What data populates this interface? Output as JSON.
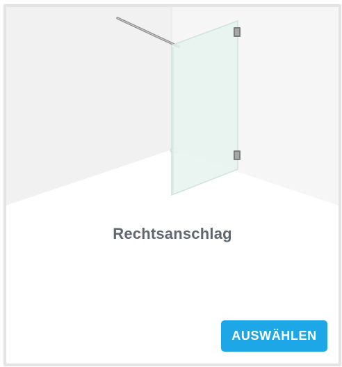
{
  "option": {
    "title": "Rechtsanschlag",
    "select_label": "AUSWÄHLEN",
    "illustration_icon": "walk-in-shower-right-hinge-illustration",
    "colors": {
      "button": "#1ea7e6",
      "title": "#5f6770",
      "card_border": "#e4e4e4"
    }
  }
}
